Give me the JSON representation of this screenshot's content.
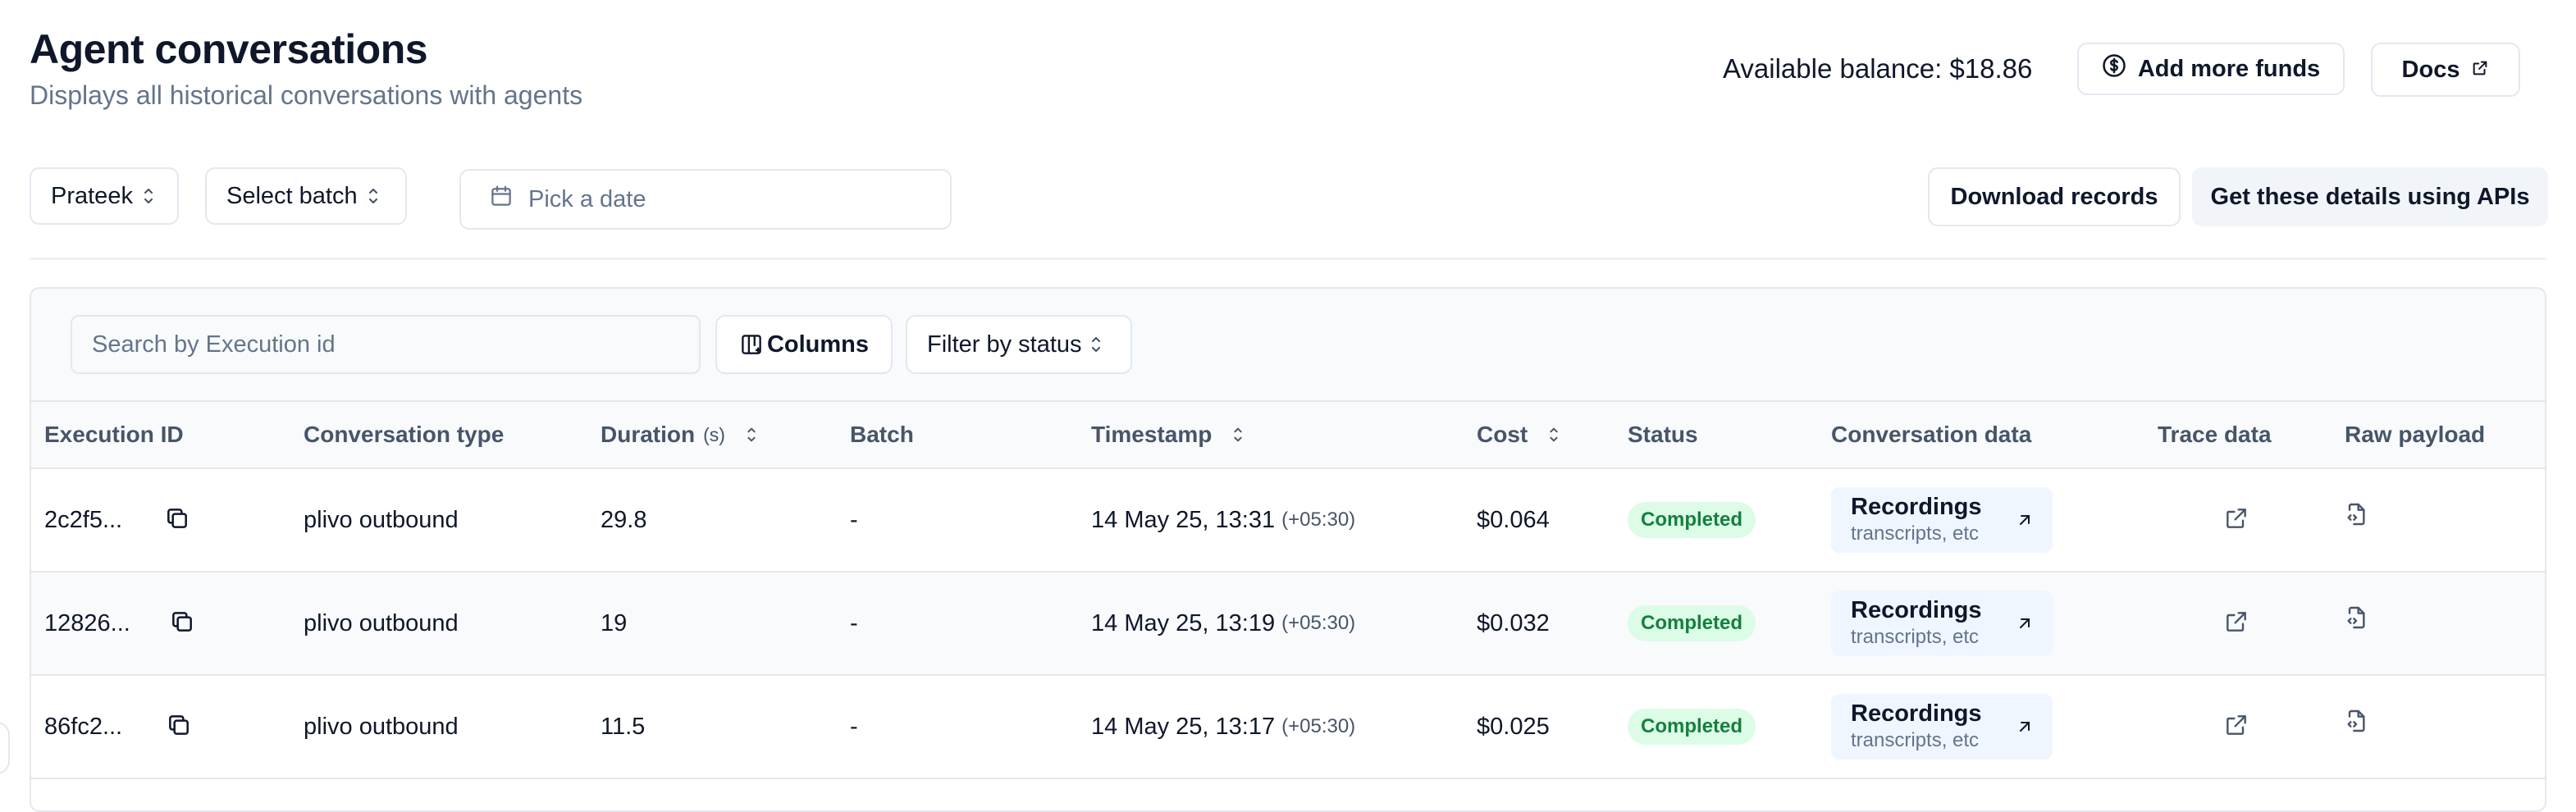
{
  "header": {
    "title": "Agent conversations",
    "subtitle": "Displays all historical conversations with agents",
    "balance": "Available balance: $18.86",
    "add_funds_label": "Add more funds",
    "docs_label": "Docs"
  },
  "filters": {
    "agent_select": "Prateek",
    "batch_select": "Select batch",
    "date_placeholder": "Pick a date",
    "download_label": "Download records",
    "api_label": "Get these details using APIs"
  },
  "toolbar": {
    "search_placeholder": "Search by Execution id",
    "columns_label": "Columns",
    "status_filter_label": "Filter by status"
  },
  "table": {
    "columns": {
      "execution_id": "Execution ID",
      "conversation_type": "Conversation type",
      "duration": "Duration",
      "duration_unit": "(s)",
      "batch": "Batch",
      "timestamp": "Timestamp",
      "cost": "Cost",
      "status": "Status",
      "conversation_data": "Conversation data",
      "trace_data": "Trace data",
      "raw_payload": "Raw payload"
    },
    "rows": [
      {
        "execution_id": "2c2f5...",
        "conversation_type": "plivo outbound",
        "duration": "29.8",
        "batch": "-",
        "timestamp": "14 May 25, 13:31",
        "tz": "(+05:30)",
        "cost": "$0.064",
        "status": "Completed",
        "data_title": "Recordings",
        "data_sub": "transcripts, etc"
      },
      {
        "execution_id": "12826...",
        "conversation_type": "plivo outbound",
        "duration": "19",
        "batch": "-",
        "timestamp": "14 May 25, 13:19",
        "tz": "(+05:30)",
        "cost": "$0.032",
        "status": "Completed",
        "data_title": "Recordings",
        "data_sub": "transcripts, etc"
      },
      {
        "execution_id": "86fc2...",
        "conversation_type": "plivo outbound",
        "duration": "11.5",
        "batch": "-",
        "timestamp": "14 May 25, 13:17",
        "tz": "(+05:30)",
        "cost": "$0.025",
        "status": "Completed",
        "data_title": "Recordings",
        "data_sub": "transcripts, etc"
      }
    ]
  },
  "icons": {
    "dollar": "dollar-circle-icon",
    "external": "external-link-icon",
    "calendar": "calendar-icon",
    "columns": "columns-icon",
    "chevrons": "chevrons-up-down-icon",
    "copy": "copy-icon",
    "arrow": "arrow-up-right-icon",
    "payload": "file-code-icon"
  },
  "colors": {
    "badge_bg": "#dcfce7",
    "badge_text": "#15803d",
    "rec_bg": "#eff6ff",
    "muted_text": "#64748b"
  }
}
